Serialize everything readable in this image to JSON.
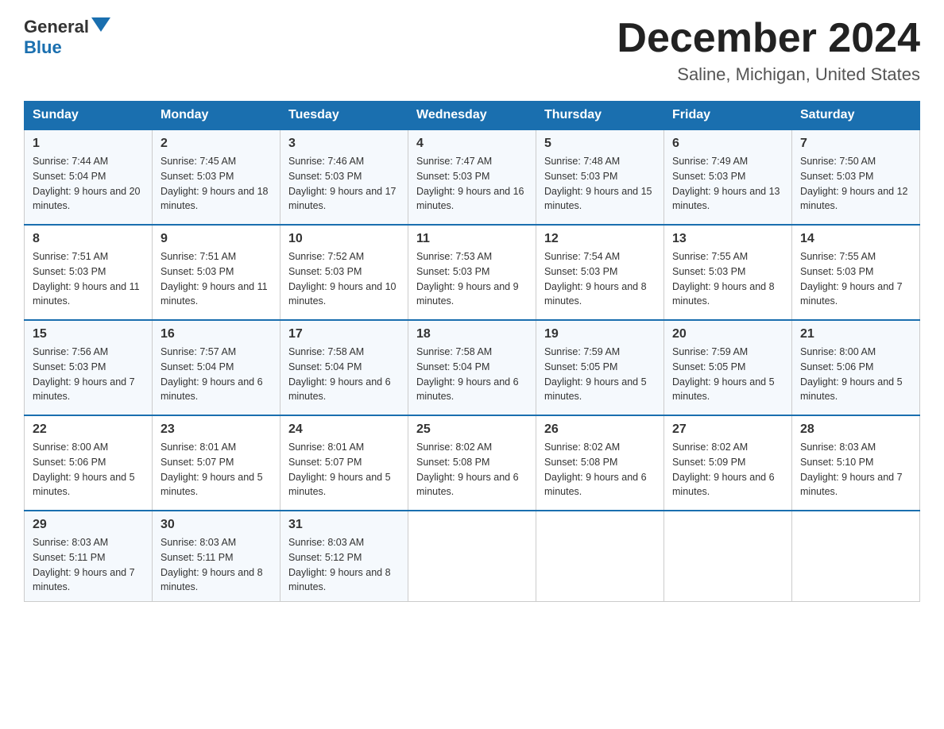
{
  "header": {
    "logo": {
      "general": "General",
      "blue": "Blue",
      "arrow": "▼"
    },
    "title": "December 2024",
    "subtitle": "Saline, Michigan, United States"
  },
  "weekdays": [
    "Sunday",
    "Monday",
    "Tuesday",
    "Wednesday",
    "Thursday",
    "Friday",
    "Saturday"
  ],
  "weeks": [
    [
      {
        "day": "1",
        "sunrise": "7:44 AM",
        "sunset": "5:04 PM",
        "daylight": "9 hours and 20 minutes."
      },
      {
        "day": "2",
        "sunrise": "7:45 AM",
        "sunset": "5:03 PM",
        "daylight": "9 hours and 18 minutes."
      },
      {
        "day": "3",
        "sunrise": "7:46 AM",
        "sunset": "5:03 PM",
        "daylight": "9 hours and 17 minutes."
      },
      {
        "day": "4",
        "sunrise": "7:47 AM",
        "sunset": "5:03 PM",
        "daylight": "9 hours and 16 minutes."
      },
      {
        "day": "5",
        "sunrise": "7:48 AM",
        "sunset": "5:03 PM",
        "daylight": "9 hours and 15 minutes."
      },
      {
        "day": "6",
        "sunrise": "7:49 AM",
        "sunset": "5:03 PM",
        "daylight": "9 hours and 13 minutes."
      },
      {
        "day": "7",
        "sunrise": "7:50 AM",
        "sunset": "5:03 PM",
        "daylight": "9 hours and 12 minutes."
      }
    ],
    [
      {
        "day": "8",
        "sunrise": "7:51 AM",
        "sunset": "5:03 PM",
        "daylight": "9 hours and 11 minutes."
      },
      {
        "day": "9",
        "sunrise": "7:51 AM",
        "sunset": "5:03 PM",
        "daylight": "9 hours and 11 minutes."
      },
      {
        "day": "10",
        "sunrise": "7:52 AM",
        "sunset": "5:03 PM",
        "daylight": "9 hours and 10 minutes."
      },
      {
        "day": "11",
        "sunrise": "7:53 AM",
        "sunset": "5:03 PM",
        "daylight": "9 hours and 9 minutes."
      },
      {
        "day": "12",
        "sunrise": "7:54 AM",
        "sunset": "5:03 PM",
        "daylight": "9 hours and 8 minutes."
      },
      {
        "day": "13",
        "sunrise": "7:55 AM",
        "sunset": "5:03 PM",
        "daylight": "9 hours and 8 minutes."
      },
      {
        "day": "14",
        "sunrise": "7:55 AM",
        "sunset": "5:03 PM",
        "daylight": "9 hours and 7 minutes."
      }
    ],
    [
      {
        "day": "15",
        "sunrise": "7:56 AM",
        "sunset": "5:03 PM",
        "daylight": "9 hours and 7 minutes."
      },
      {
        "day": "16",
        "sunrise": "7:57 AM",
        "sunset": "5:04 PM",
        "daylight": "9 hours and 6 minutes."
      },
      {
        "day": "17",
        "sunrise": "7:58 AM",
        "sunset": "5:04 PM",
        "daylight": "9 hours and 6 minutes."
      },
      {
        "day": "18",
        "sunrise": "7:58 AM",
        "sunset": "5:04 PM",
        "daylight": "9 hours and 6 minutes."
      },
      {
        "day": "19",
        "sunrise": "7:59 AM",
        "sunset": "5:05 PM",
        "daylight": "9 hours and 5 minutes."
      },
      {
        "day": "20",
        "sunrise": "7:59 AM",
        "sunset": "5:05 PM",
        "daylight": "9 hours and 5 minutes."
      },
      {
        "day": "21",
        "sunrise": "8:00 AM",
        "sunset": "5:06 PM",
        "daylight": "9 hours and 5 minutes."
      }
    ],
    [
      {
        "day": "22",
        "sunrise": "8:00 AM",
        "sunset": "5:06 PM",
        "daylight": "9 hours and 5 minutes."
      },
      {
        "day": "23",
        "sunrise": "8:01 AM",
        "sunset": "5:07 PM",
        "daylight": "9 hours and 5 minutes."
      },
      {
        "day": "24",
        "sunrise": "8:01 AM",
        "sunset": "5:07 PM",
        "daylight": "9 hours and 5 minutes."
      },
      {
        "day": "25",
        "sunrise": "8:02 AM",
        "sunset": "5:08 PM",
        "daylight": "9 hours and 6 minutes."
      },
      {
        "day": "26",
        "sunrise": "8:02 AM",
        "sunset": "5:08 PM",
        "daylight": "9 hours and 6 minutes."
      },
      {
        "day": "27",
        "sunrise": "8:02 AM",
        "sunset": "5:09 PM",
        "daylight": "9 hours and 6 minutes."
      },
      {
        "day": "28",
        "sunrise": "8:03 AM",
        "sunset": "5:10 PM",
        "daylight": "9 hours and 7 minutes."
      }
    ],
    [
      {
        "day": "29",
        "sunrise": "8:03 AM",
        "sunset": "5:11 PM",
        "daylight": "9 hours and 7 minutes."
      },
      {
        "day": "30",
        "sunrise": "8:03 AM",
        "sunset": "5:11 PM",
        "daylight": "9 hours and 8 minutes."
      },
      {
        "day": "31",
        "sunrise": "8:03 AM",
        "sunset": "5:12 PM",
        "daylight": "9 hours and 8 minutes."
      },
      null,
      null,
      null,
      null
    ]
  ]
}
